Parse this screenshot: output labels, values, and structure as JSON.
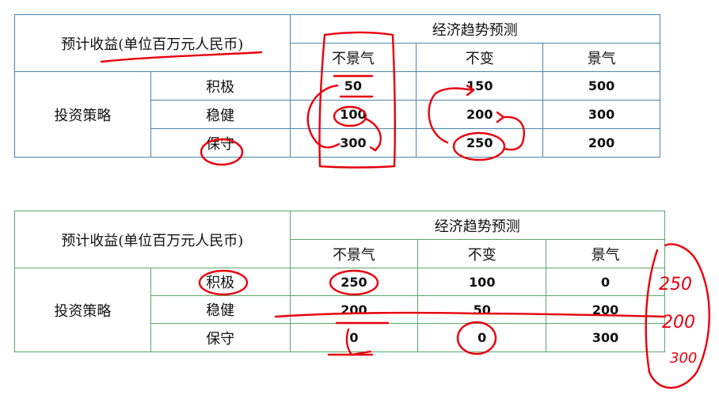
{
  "table1": {
    "corner": "预计收益(单位百万元人民币)",
    "group_header": "经济趋势预测",
    "columns": [
      "不景气",
      "不变",
      "景气"
    ],
    "row_group": "投资策略",
    "rows": [
      {
        "label": "积极",
        "values": [
          "50",
          "150",
          "500"
        ]
      },
      {
        "label": "稳健",
        "values": [
          "100",
          "200",
          "300"
        ]
      },
      {
        "label": "保守",
        "values": [
          "300",
          "250",
          "200"
        ]
      }
    ]
  },
  "table2": {
    "corner": "预计收益(单位百万元人民币)",
    "group_header": "经济趋势预测",
    "columns": [
      "不景气",
      "不变",
      "景气"
    ],
    "row_group": "投资策略",
    "rows": [
      {
        "label": "积极",
        "values": [
          "250",
          "100",
          "0"
        ]
      },
      {
        "label": "稳健",
        "values": [
          "200",
          "50",
          "200"
        ]
      },
      {
        "label": "保守",
        "values": [
          "0",
          "0",
          "300"
        ]
      }
    ]
  },
  "annotations": {
    "margin_notes": [
      "250",
      "200",
      "300"
    ],
    "ink_color": "#e8000d"
  }
}
